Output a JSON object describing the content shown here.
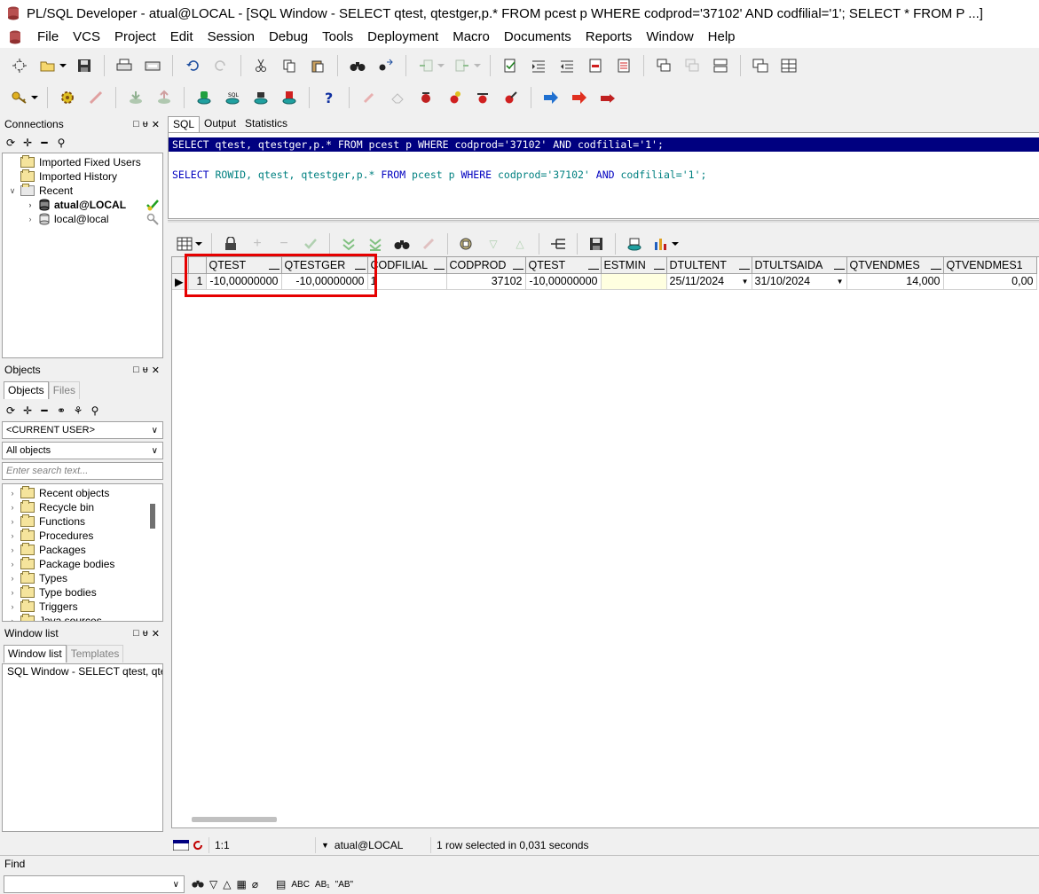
{
  "window": {
    "title": "PL/SQL Developer - atual@LOCAL - [SQL Window - SELECT qtest, qtestger,p.* FROM pcest p WHERE codprod='37102' AND codfilial='1'; SELECT * FROM P ...]"
  },
  "menu": [
    "File",
    "VCS",
    "Project",
    "Edit",
    "Session",
    "Debug",
    "Tools",
    "Deployment",
    "Macro",
    "Documents",
    "Reports",
    "Window",
    "Help"
  ],
  "connections": {
    "header": "Connections",
    "items": [
      {
        "label": "Imported Fixed Users"
      },
      {
        "label": "Imported History"
      },
      {
        "label": "Recent"
      },
      {
        "label": "atual@LOCAL"
      },
      {
        "label": "local@local"
      }
    ]
  },
  "objects": {
    "header": "Objects",
    "tabs": [
      "Objects",
      "Files"
    ],
    "user_combo": "<CURRENT USER>",
    "filter_combo": "All objects",
    "search_placeholder": "Enter search text...",
    "tree": [
      "Recent objects",
      "Recycle bin",
      "Functions",
      "Procedures",
      "Packages",
      "Package bodies",
      "Types",
      "Type bodies",
      "Triggers",
      "Java sources"
    ]
  },
  "window_list": {
    "header": "Window list",
    "tabs": [
      "Window list",
      "Templates"
    ],
    "item": "SQL Window - SELECT qtest, qtes"
  },
  "editor": {
    "tabs": [
      "SQL",
      "Output",
      "Statistics"
    ],
    "line1": {
      "parts": [
        "SELECT qtest, qtestger,p.* FROM pcest p WHERE codprod='37102' AND codfilial='1';"
      ]
    },
    "line2": {
      "kw1": "SELECT",
      "t1": " ROWID, qtest, qtestger,p.* ",
      "kw2": "FROM",
      "t2": " pcest p ",
      "kw3": "WHERE",
      "t3": " codprod=",
      "s1": "'37102'",
      "t4": " ",
      "kw4": "AND",
      "t5": " codfilial=",
      "s2": "'1'",
      "t6": ";"
    }
  },
  "grid": {
    "columns": [
      "QTEST",
      "QTESTGER",
      "CODFILIAL",
      "CODPROD",
      "QTEST",
      "ESTMIN",
      "DTULTENT",
      "DTULTSAIDA",
      "QTVENDMES",
      "QTVENDMES1"
    ],
    "row": {
      "num": "1",
      "qtest": "-10,00000000",
      "qtestger": "-10,00000000",
      "codfilial": "1",
      "codprod": "37102",
      "qtest2": "-10,00000000",
      "estmin": "",
      "dtultent": "25/11/2024",
      "dtultsaida": "31/10/2024",
      "qtvendmes": "14,000",
      "qtvendmes1": "0,00"
    }
  },
  "status": {
    "position": "1:1",
    "connection": "atual@LOCAL",
    "message": "1 row selected in 0,031 seconds"
  },
  "find": {
    "label": "Find",
    "tools": [
      "ABC",
      "AB₁",
      "\"AB\""
    ]
  }
}
